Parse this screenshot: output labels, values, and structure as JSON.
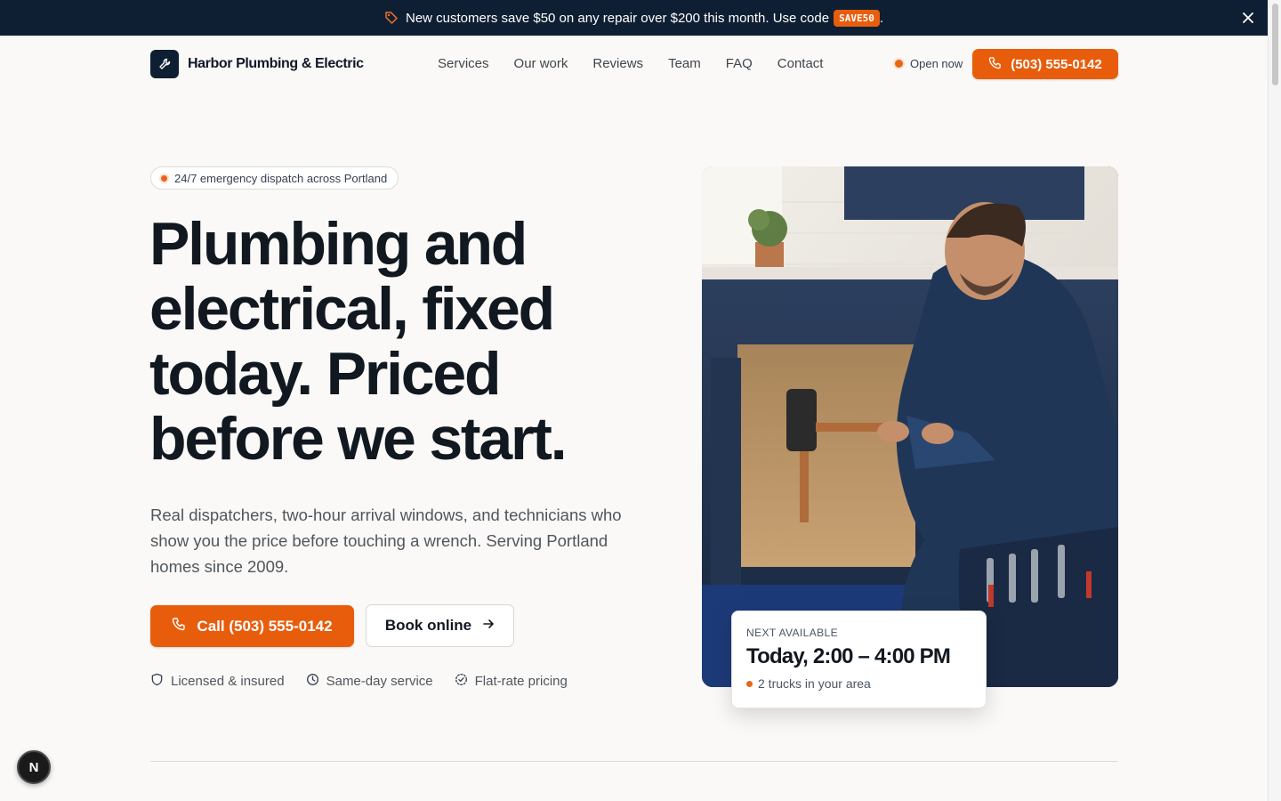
{
  "promo": {
    "icon": "tag-icon",
    "text": "New customers save $50 on any repair over $200 this month. Use code",
    "code": "SAVE50",
    "period": ".",
    "close_icon": "close-icon"
  },
  "brand": {
    "name": "Harbor Plumbing & Electric",
    "logo_icon": "wrench-icon",
    "accent": "#e85d0c",
    "navy": "#0f1f33"
  },
  "nav": {
    "items": [
      "Services",
      "Our work",
      "Reviews",
      "Team",
      "FAQ",
      "Contact"
    ]
  },
  "header": {
    "status": "Open now",
    "phone_label": "(503) 555-0142"
  },
  "hero": {
    "badge": "24/7 emergency dispatch across Portland",
    "headline": "Plumbing and electrical, fixed today. Priced before we start.",
    "subtext": "Real dispatchers, two-hour arrival windows, and technicians who show you the price before touching a wrench. Serving Portland homes since 2009.",
    "cta_primary": "Call (503) 555-0142",
    "cta_secondary": "Book online",
    "features": [
      {
        "label": "Licensed & insured",
        "icon": "shield-icon"
      },
      {
        "label": "Same-day service",
        "icon": "clock-icon"
      },
      {
        "label": "Flat-rate pricing",
        "icon": "check-badge-icon"
      }
    ]
  },
  "availability": {
    "label": "NEXT AVAILABLE",
    "time": "Today, 2:00 – 4:00 PM",
    "trucks": "2 trucks in your area"
  },
  "dev_badge": "N"
}
